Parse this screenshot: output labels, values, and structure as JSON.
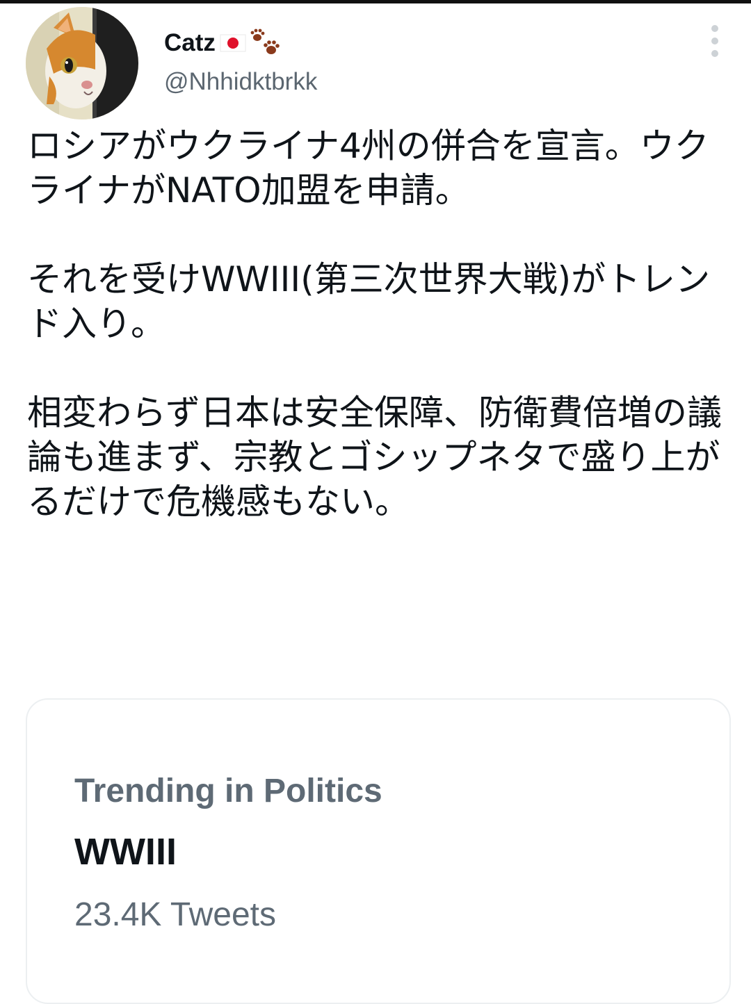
{
  "author": {
    "display_name": "Catz",
    "handle": "@Nhhidktbrkk",
    "avatar_icon": "cat-photo-avatar",
    "name_emoji": [
      "japan-flag-icon",
      "paw-prints-icon"
    ]
  },
  "tweet": {
    "paragraphs": [
      "ロシアがウクライナ4州の併合を宣言。ウクライナがNATO加盟を申請。",
      "それを受けWWIII(第三次世界大戦)がトレンド入り。",
      "相変わらず日本は安全保障、防衛費倍増の議論も進まず、宗教とゴシップネタで盛り上がるだけで危機感もない。"
    ]
  },
  "trend_card": {
    "context": "Trending in Politics",
    "name": "WWIII",
    "count": "23.4K Tweets"
  },
  "colors": {
    "text_primary": "#0f1419",
    "text_secondary": "#5e6a75",
    "card_border": "#eceff1",
    "flag_red": "#e0112b",
    "paw_brown": "#8a3a1c"
  }
}
